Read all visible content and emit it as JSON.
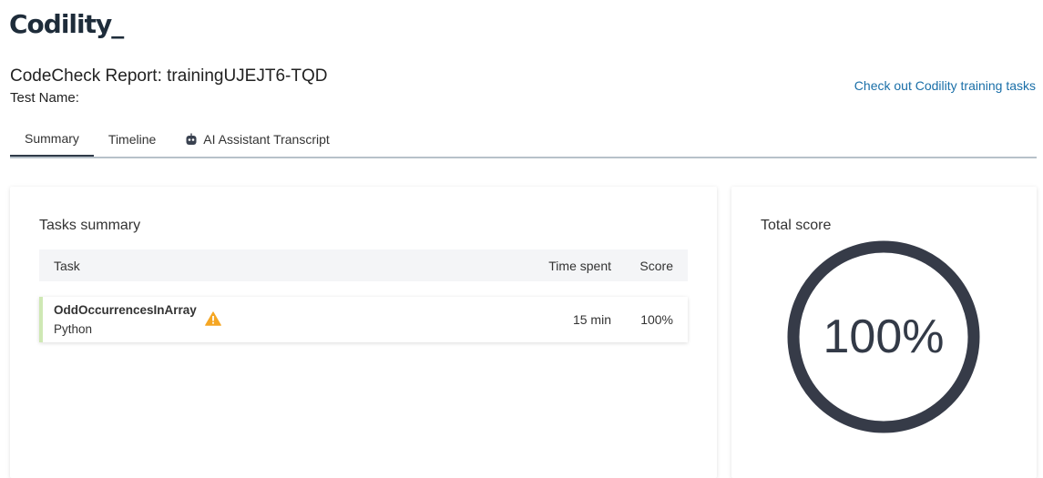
{
  "brand": {
    "logo_text": "Codility_"
  },
  "header": {
    "report_title": "CodeCheck Report: trainingUJEJT6-TQD",
    "test_name_label": "Test Name:",
    "training_link": "Check out Codility training tasks"
  },
  "tabs": [
    {
      "label": "Summary",
      "active": true
    },
    {
      "label": "Timeline",
      "active": false
    },
    {
      "label": "AI Assistant Transcript",
      "active": false,
      "icon": "robot-icon"
    }
  ],
  "tasks_summary": {
    "title": "Tasks summary",
    "columns": {
      "task": "Task",
      "time": "Time spent",
      "score": "Score"
    },
    "rows": [
      {
        "name": "OddOccurrencesInArray",
        "language": "Python",
        "warning_icon": "warning-icon",
        "time_spent": "15 min",
        "score": "100%",
        "status_color": "#cfe8b4"
      }
    ]
  },
  "total_score": {
    "title": "Total score",
    "value_text": "100%",
    "fraction": 1.0,
    "ring_color": "#363b48"
  },
  "colors": {
    "link": "#1a6fa8",
    "warning": "#f5a623"
  }
}
